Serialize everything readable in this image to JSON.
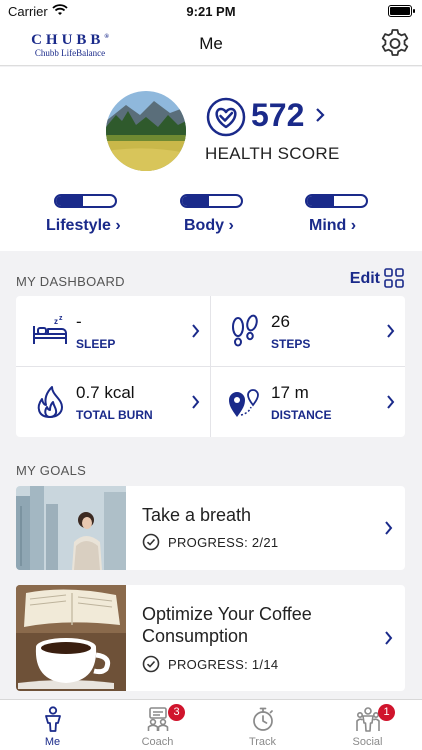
{
  "status_bar": {
    "carrier": "Carrier",
    "time": "9:21 PM"
  },
  "nav": {
    "logo_brand": "CHUBB",
    "logo_reg": "®",
    "logo_sub": "Chubb LifeBalance",
    "title": "Me"
  },
  "health": {
    "score": "572",
    "label": "HEALTH SCORE"
  },
  "categories": [
    {
      "label": "Lifestyle ›",
      "progress": 0.45
    },
    {
      "label": "Body ›",
      "progress": 0.45
    },
    {
      "label": "Mind ›",
      "progress": 0.45
    }
  ],
  "dashboard": {
    "title": "MY DASHBOARD",
    "edit_label": "Edit",
    "tiles": [
      {
        "value": "-",
        "label": "SLEEP",
        "icon": "sleep-icon"
      },
      {
        "value": "26",
        "label": "STEPS",
        "icon": "footsteps-icon"
      },
      {
        "value": "0.7 kcal",
        "label": "TOTAL BURN",
        "icon": "flame-icon"
      },
      {
        "value": "17 m",
        "label": "DISTANCE",
        "icon": "distance-icon"
      }
    ]
  },
  "goals": {
    "title": "MY GOALS",
    "items": [
      {
        "title_lines": [
          "Take a breath"
        ],
        "progress": "PROGRESS: 2/21"
      },
      {
        "title_lines": [
          "Optimize Your Coffee",
          "Consumption"
        ],
        "progress": "PROGRESS: 1/14"
      }
    ]
  },
  "tabs": [
    {
      "label": "Me",
      "active": true
    },
    {
      "label": "Coach",
      "badge": "3"
    },
    {
      "label": "Track"
    },
    {
      "label": "Social",
      "badge": "1"
    }
  ],
  "colors": {
    "brand": "#1a2a8a",
    "badge": "#d0142c",
    "background": "#f2f2f4"
  }
}
